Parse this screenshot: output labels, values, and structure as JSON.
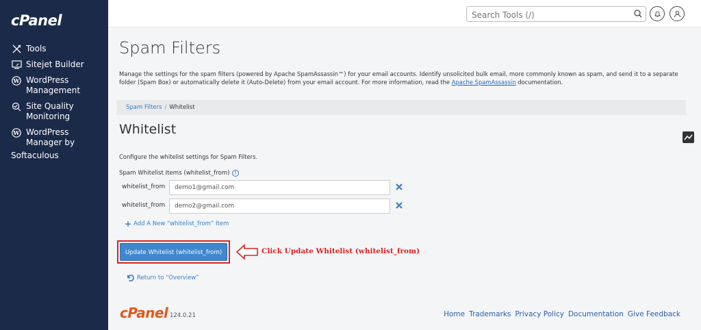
{
  "app": {
    "logo": "cPanel",
    "version": "124.0.21"
  },
  "sidebar": {
    "items": [
      {
        "label": "Tools",
        "icon": "tools-icon"
      },
      {
        "label": "Sitejet Builder",
        "icon": "sitejet-icon"
      },
      {
        "label": "WordPress\nManagement",
        "icon": "wordpress-icon"
      },
      {
        "label": "Site Quality\nMonitoring",
        "icon": "site-quality-icon"
      },
      {
        "label": "WordPress\nManager by",
        "icon": "wordpress-icon"
      }
    ],
    "trailing": "Softaculous"
  },
  "topbar": {
    "search_placeholder": "Search Tools (/)"
  },
  "page": {
    "title": "Spam Filters",
    "description": "Manage the settings for the spam filters (powered by Apache SpamAssassin™) for your email accounts. Identify unsolicited bulk email, more commonly known as spam, and send it to a separate folder (Spam Box) or automatically delete it (Auto-Delete) from your email account. For more information, read the ",
    "description_link": "Apache SpamAssassin",
    "description_end": " documentation.",
    "breadcrumb": {
      "parent": "Spam Filters",
      "separator": "/",
      "current": "Whitelist"
    },
    "section_title": "Whitelist",
    "section_desc": "Configure the whitelist settings for Spam Filters.",
    "list_label": "Spam Whitelist Items (whitelist_from)",
    "help_glyph": "?",
    "rows": [
      {
        "field": "whitelist_from",
        "value": "demo1@gmail.com"
      },
      {
        "field": "whitelist_from",
        "value": "demo2@gmail.com"
      }
    ],
    "add_label": "Add A New “whitelist_from” Item",
    "add_glyph": "+",
    "update_button": "Update Whitelist (whitelist_from)",
    "annotation": "Click Update Whitelist (whitelist_from)",
    "return_label": "Return to “Overview”"
  },
  "footer": {
    "logo": "cPanel",
    "version": "124.0.21",
    "links": [
      "Home",
      "Trademarks",
      "Privacy Policy",
      "Documentation",
      "Give Feedback"
    ]
  },
  "colors": {
    "sidebar": "#1c2a4a",
    "accent": "#3f87ce",
    "annotation": "#d62424",
    "brand": "#e0591e"
  }
}
